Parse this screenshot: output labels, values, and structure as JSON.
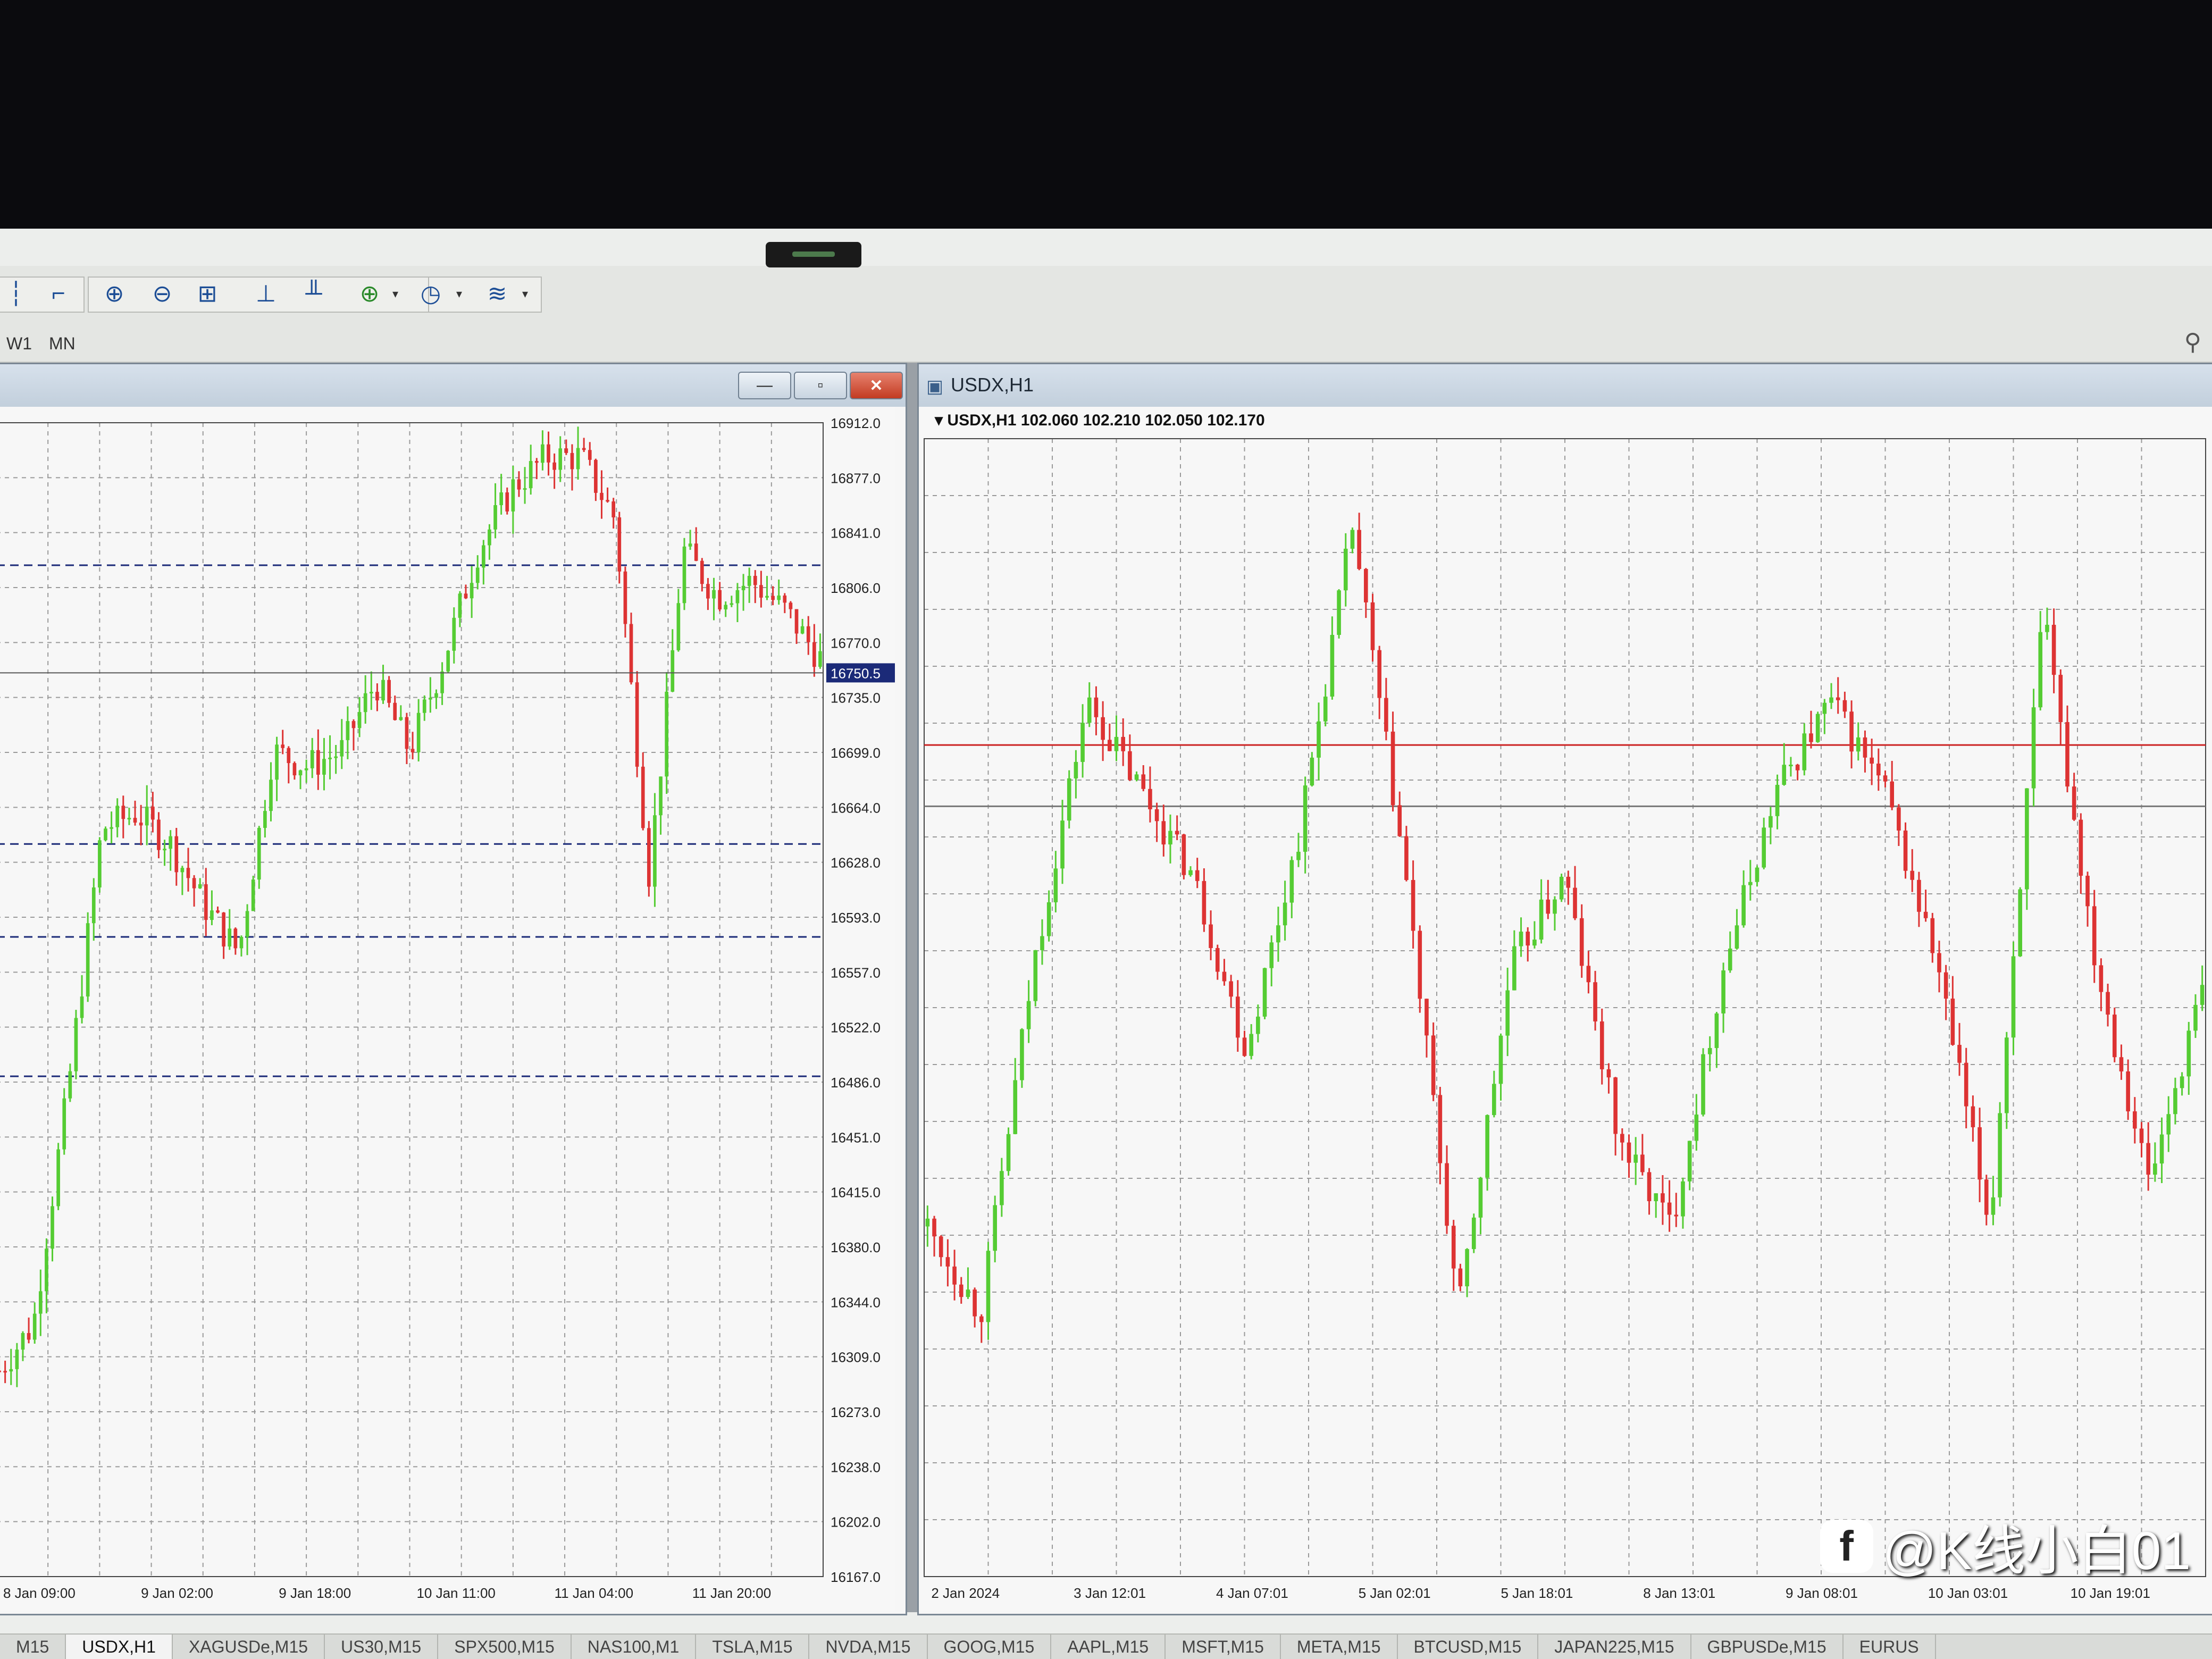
{
  "timeframes": [
    "W1",
    "MN"
  ],
  "toolbar_icons": [
    "bar-chart-icon",
    "line-chart-icon",
    "zoom-in-icon",
    "zoom-out-icon",
    "tile-windows-icon",
    "autoscroll-icon",
    "chart-shift-icon",
    "indicators-icon",
    "periods-icon",
    "templates-icon"
  ],
  "left_window": {
    "price_labels": [
      "16912.0",
      "16877.0",
      "16841.0",
      "16806.0",
      "16770.0",
      "16735.0",
      "16699.0",
      "16664.0",
      "16628.0",
      "16593.0",
      "16557.0",
      "16522.0",
      "16486.0",
      "16451.0",
      "16415.0",
      "16380.0",
      "16344.0",
      "16309.0",
      "16273.0",
      "16238.0",
      "16202.0",
      "16167.0"
    ],
    "current_price": "16750.5",
    "time_labels": [
      "8 Jan 09:00",
      "9 Jan 02:00",
      "9 Jan 18:00",
      "10 Jan 11:00",
      "11 Jan 04:00",
      "11 Jan 20:00"
    ],
    "controls": {
      "minimize": "—",
      "restore": "▫",
      "close": "✕"
    }
  },
  "right_window": {
    "title": "USDX,H1",
    "info": {
      "symbol": "USDX,H1",
      "open": "102.060",
      "high": "102.210",
      "low": "102.050",
      "close": "102.170"
    },
    "time_labels": [
      "2 Jan 2024",
      "3 Jan 12:01",
      "4 Jan 07:01",
      "5 Jan 02:01",
      "5 Jan 18:01",
      "8 Jan 13:01",
      "9 Jan 08:01",
      "10 Jan 03:01",
      "10 Jan 19:01"
    ]
  },
  "symbol_tabs": [
    "M15",
    "USDX,H1",
    "XAGUSDe,M15",
    "US30,M15",
    "SPX500,M15",
    "NAS100,M1",
    "TSLA,M15",
    "NVDA,M15",
    "GOOG,M15",
    "AAPL,M15",
    "MSFT,M15",
    "META,M15",
    "BTCUSD,M15",
    "JAPAN225,M15",
    "GBPUSDe,M15",
    "EURUS"
  ],
  "watermark": "@K线小白01",
  "colors": {
    "bull": "#55cc33",
    "bear": "#dd3333",
    "grid": "#9a9a9a",
    "price_tag_bg": "#1b2a78"
  },
  "chart_data": [
    {
      "type": "line",
      "title": "",
      "x": [
        "8 Jan 09:00",
        "9 Jan 02:00",
        "9 Jan 18:00",
        "10 Jan 11:00",
        "11 Jan 04:00",
        "11 Jan 20:00"
      ],
      "series": [
        {
          "values": [
            16300,
            16330,
            16480,
            16650,
            16660,
            16640,
            16600,
            16570,
            16700,
            16690,
            16700,
            16745,
            16700,
            16760,
            16830,
            16870,
            16890,
            16890,
            16850,
            16620,
            16830,
            16800,
            16810,
            16790,
            16760
          ]
        }
      ],
      "ylim": [
        16167.0,
        16912.0
      ],
      "current_price": 16750.5,
      "grid": true
    },
    {
      "type": "line",
      "title": "",
      "x": [
        "2 Jan 2024",
        "3 Jan 12:01",
        "4 Jan 07:01",
        "5 Jan 02:01",
        "5 Jan 18:01",
        "8 Jan 13:01",
        "9 Jan 08:01",
        "10 Jan 03:01",
        "10 Jan 19:01"
      ],
      "series": [
        {
          "name": "USDX,H1",
          "values": [
            101.9,
            101.8,
            102.2,
            102.5,
            102.4,
            102.3,
            102.1,
            102.35,
            102.7,
            102.3,
            101.8,
            102.2,
            102.3,
            102.0,
            101.9,
            102.2,
            102.4,
            102.5,
            102.4,
            102.2,
            101.9,
            102.6,
            102.2,
            101.95,
            102.17
          ]
        }
      ],
      "ylim": [
        101.5,
        102.8
      ],
      "grid": true
    }
  ]
}
